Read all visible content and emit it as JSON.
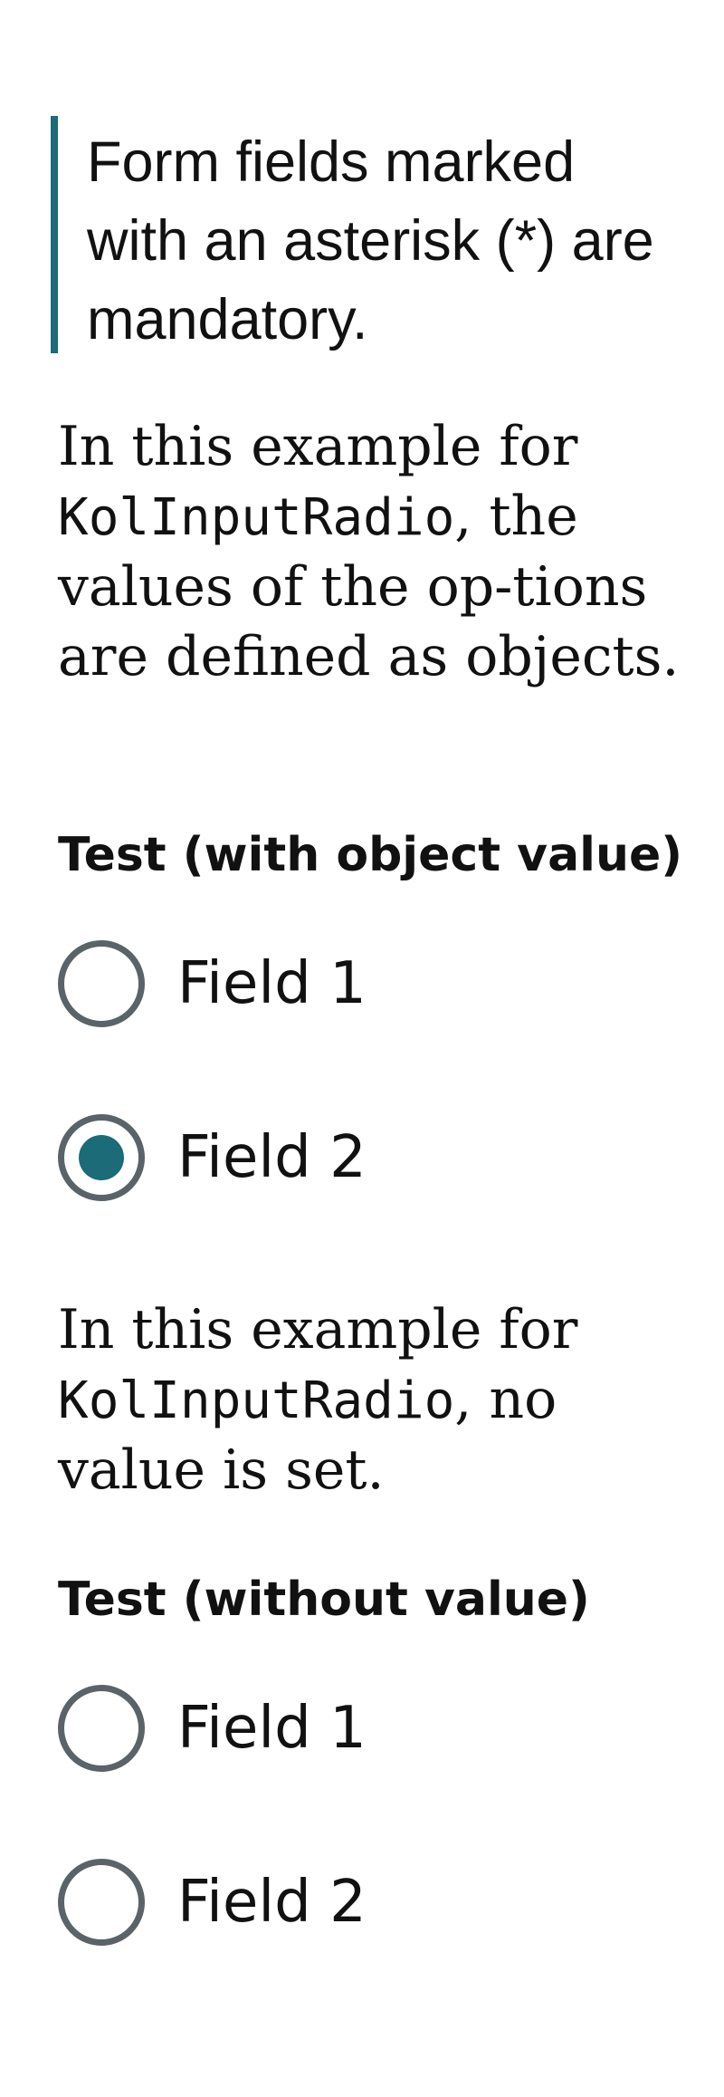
{
  "notice": {
    "text": "Form fields marked with an asterisk (*) are mandatory."
  },
  "example_object_value": {
    "intro_before": "In this example for ",
    "component": "KolInputRadio",
    "intro_after": ", the values of the op-tions are defined as objects.",
    "legend": "Test (with object value)",
    "options": [
      {
        "label": "Field 1",
        "checked": false
      },
      {
        "label": "Field 2",
        "checked": true
      }
    ]
  },
  "example_without_value": {
    "intro_before": "In this example for ",
    "component": "KolInputRadio",
    "intro_after": ", no value is set.",
    "legend": "Test (without value)",
    "options": [
      {
        "label": "Field 1",
        "checked": false
      },
      {
        "label": "Field 2",
        "checked": false
      }
    ]
  },
  "colors": {
    "accent": "#1b6b78",
    "radio_border": "#5a6468"
  }
}
